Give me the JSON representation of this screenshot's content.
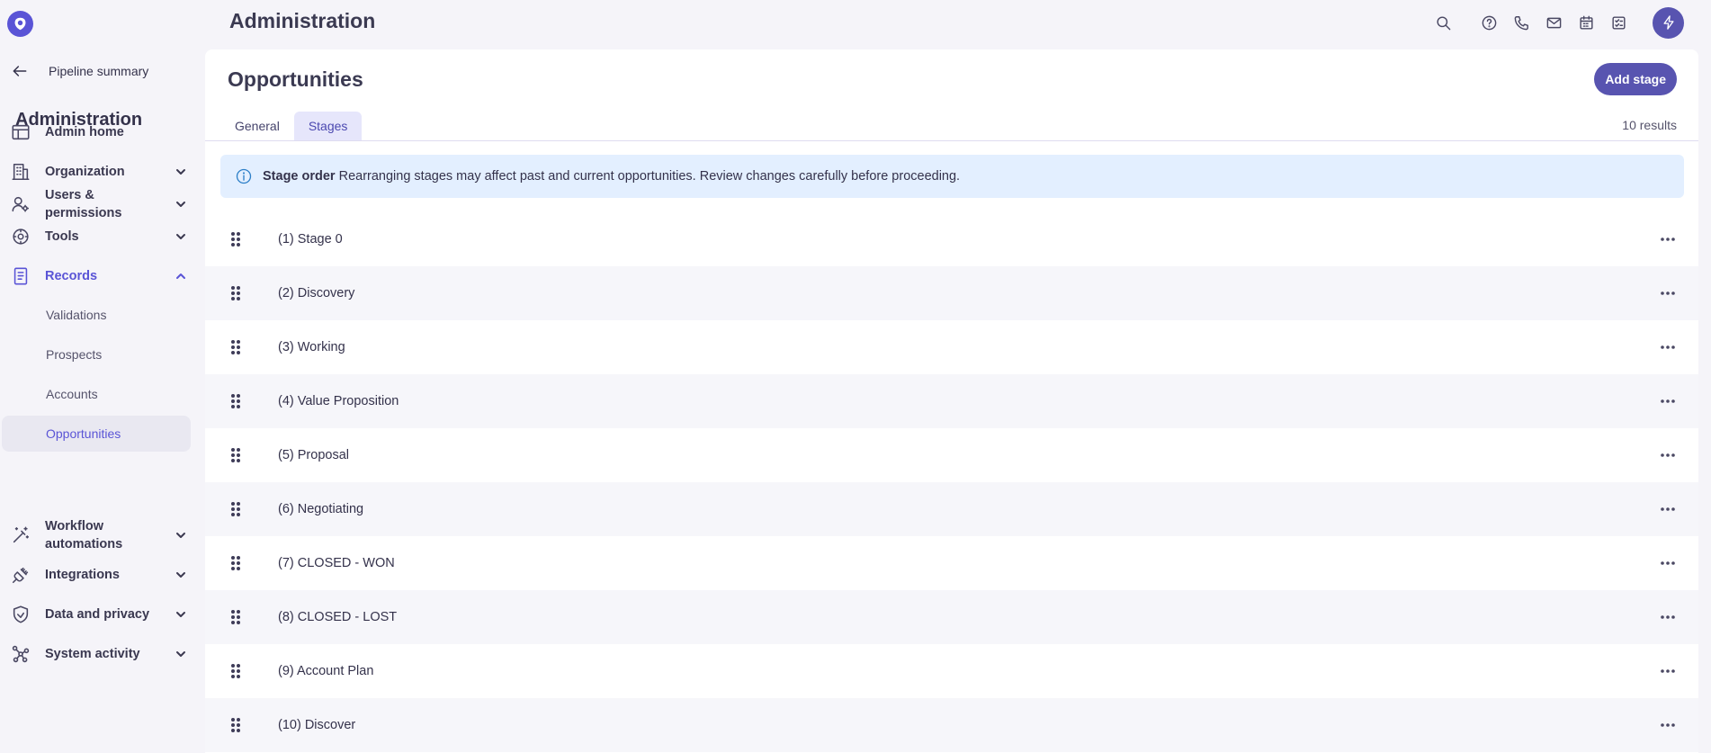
{
  "header": {
    "title": "Administration",
    "icons": [
      "search-icon",
      "help-icon",
      "phone-icon",
      "mail-icon",
      "calendar-icon",
      "tasks-icon",
      "bolt-icon"
    ]
  },
  "sidebar": {
    "back_label": "Pipeline summary",
    "title": "Administration",
    "items": [
      {
        "label": "Admin home",
        "icon": "layout-icon"
      },
      {
        "label": "Organization",
        "icon": "building-icon"
      },
      {
        "label": "Users & permissions",
        "icon": "user-settings-icon"
      },
      {
        "label": "Tools",
        "icon": "tools-icon"
      },
      {
        "label": "Records",
        "icon": "records-icon"
      },
      {
        "label": "Workflow automations",
        "icon": "magic-wand-icon"
      },
      {
        "label": "Integrations",
        "icon": "plug-icon"
      },
      {
        "label": "Data and privacy",
        "icon": "shield-icon"
      },
      {
        "label": "System activity",
        "icon": "network-icon"
      }
    ],
    "records_sub": [
      "Validations",
      "Prospects",
      "Accounts",
      "Opportunities"
    ]
  },
  "main": {
    "title": "Opportunities",
    "add_button": "Add stage",
    "tabs": [
      "General",
      "Stages"
    ],
    "active_tab": "Stages",
    "results": "10 results",
    "banner": {
      "title": "Stage order",
      "text": "Rearranging stages may affect past and current opportunities. Review changes carefully before proceeding."
    },
    "stages": [
      "(1) Stage 0",
      "(2) Discovery",
      "(3) Working",
      "(4) Value Proposition",
      "(5) Proposal",
      "(6) Negotiating",
      "(7) CLOSED - WON",
      "(8) CLOSED - LOST",
      "(9) Account Plan",
      "(10) Discover"
    ]
  },
  "colors": {
    "accent": "#5854b0",
    "brand": "#5a54d6",
    "banner_bg": "#e3efff",
    "page_bg": "#f5f4f9"
  }
}
